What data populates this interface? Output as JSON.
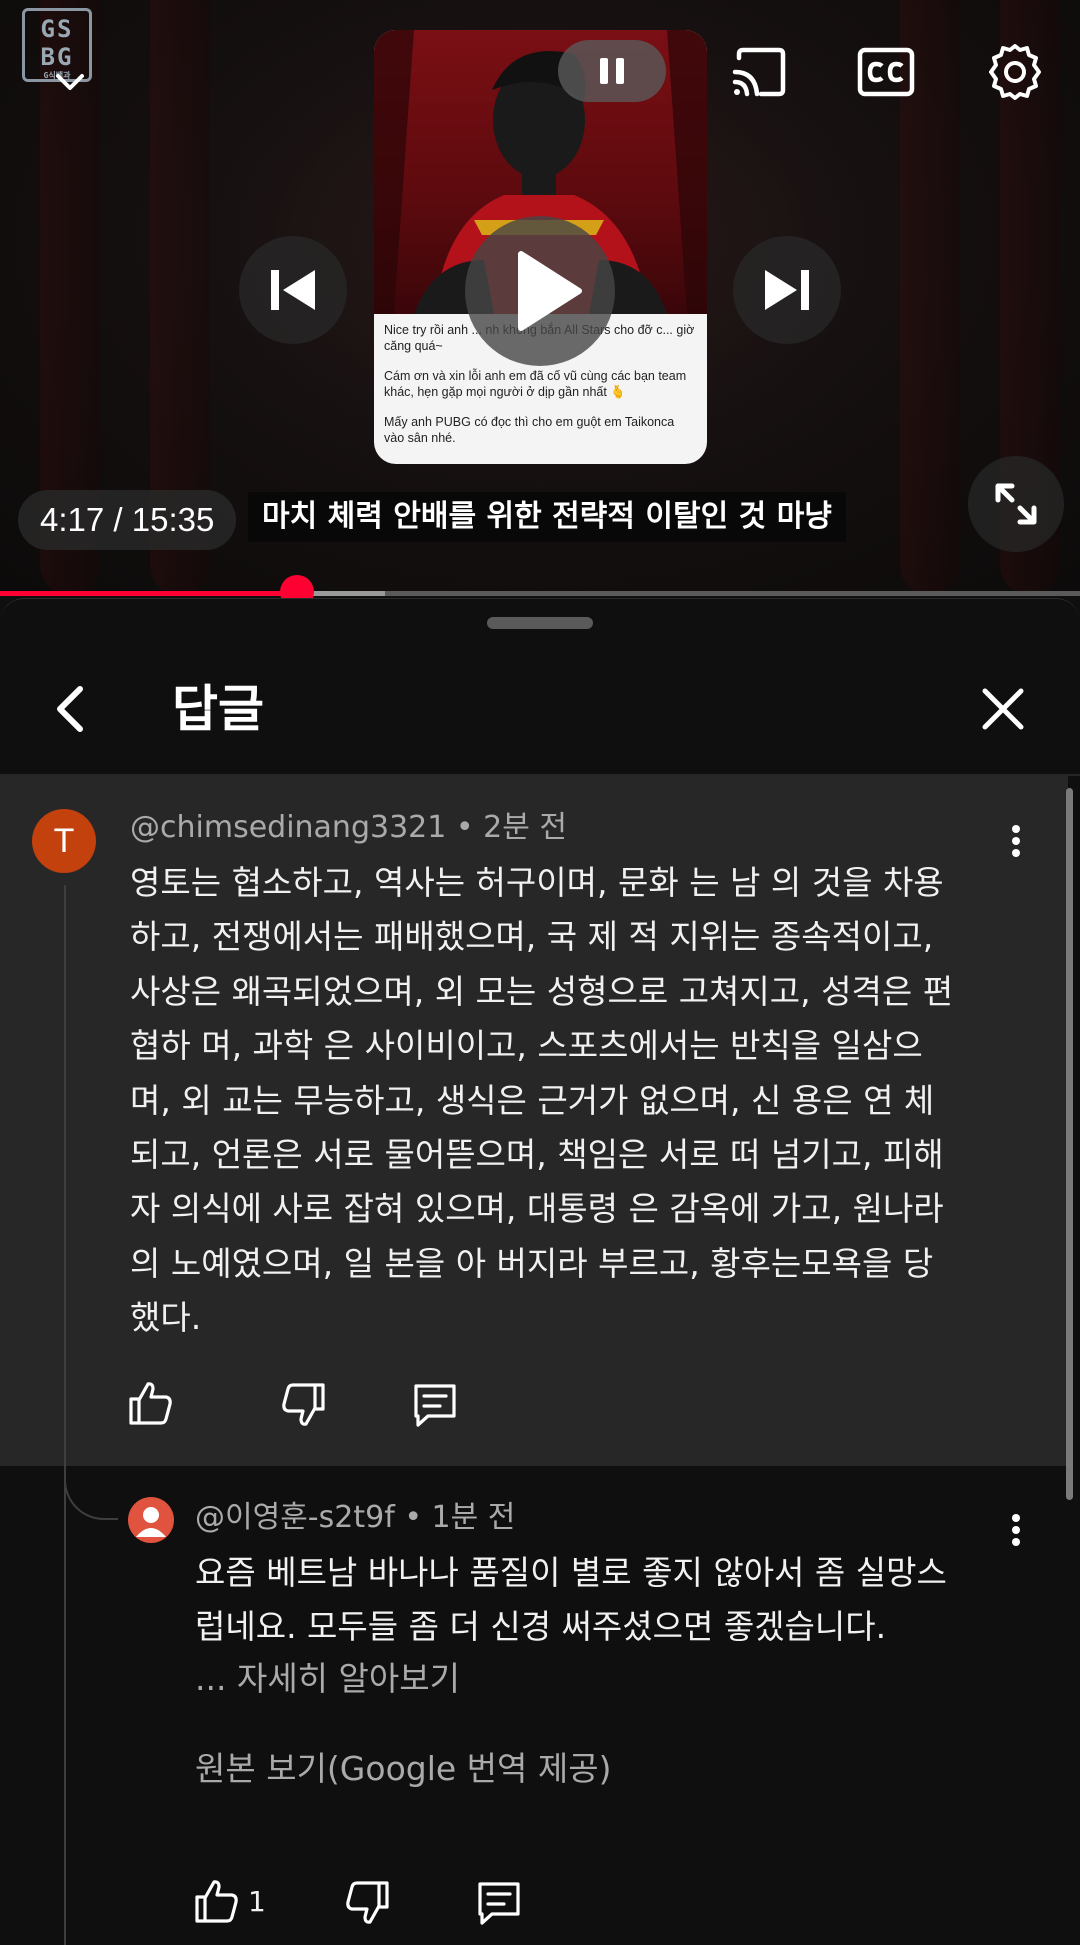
{
  "player": {
    "channel_logo": {
      "line1": "GS",
      "line2": "BG",
      "sub": "G식백과"
    },
    "time_display": "4:17 / 15:35",
    "caption": "마치 체력 안배를 위한 전략적 이탈인 것 마냥",
    "progress": {
      "current_seconds": 257,
      "duration_seconds": 935
    },
    "thumbnail_text": [
      "Nice try rồi anh ... nh không bắn All Stars cho đỡ c... giờ căng quá~",
      "Cám ơn và xin lỗi anh em đã cố vũ cùng các bạn team khác, hẹn gặp mọi người ở dịp gần nhất 🫰",
      "Mấy anh PUBG có đọc thì cho em guột em Taikonca vào sân nhé."
    ],
    "icons": [
      "collapse-icon",
      "pause-icon",
      "cast-icon",
      "captions-icon",
      "settings-icon",
      "previous-icon",
      "play-icon",
      "next-icon",
      "fullscreen-icon"
    ]
  },
  "panel": {
    "title": "답글",
    "icons": [
      "back-icon",
      "close-icon"
    ]
  },
  "main_comment": {
    "avatar_letter": "T",
    "avatar_color": "#c2410c",
    "author": "@chimsedinang3321",
    "time": "2분 전",
    "lines": [
      "영토는 협소하고, 역사는 허구이며, 문화 는 남 의 것을 차용",
      "하고, 전쟁에서는 패배했으며, 국 제 적 지위는 종속적이고,",
      "사상은 왜곡되었으며, 외 모는 성형으로 고쳐지고, 성격은 편",
      "협하 며, 과학 은 사이비이고, 스포츠에서는 반칙을 일삼으",
      "며, 외 교는 무능하고, 생식은 근거가 없으며, 신 용은 연 체",
      "되고, 언론은 서로 물어뜯으며, 책임은 서로 떠 넘기고, 피해",
      "자 의식에 사로 잡혀 있으며, 대통령 은 감옥에 가고, 원나라",
      "의 노예였으며, 일 본을 아 버지라 부르고, 황후는모욕을 당",
      "했다."
    ]
  },
  "reply": {
    "author": "@이영훈-s2t9f",
    "time": "1분 전",
    "lines": [
      "요즘 베트남 바나나 품질이 별로 좋지 않아서 좀 실망스",
      "럽네요. 모두들 좀 더 신경 써주셨으면 좋겠습니다."
    ],
    "read_more": "... 자세히 알아보기",
    "translation_label": "원본 보기(Google 번역 제공)",
    "like_count": "1"
  },
  "colors": {
    "accent": "#ff0033",
    "panel_bg": "#0f0f0f",
    "highlight_bg": "#272727",
    "secondary_text": "#aaaaaa"
  }
}
